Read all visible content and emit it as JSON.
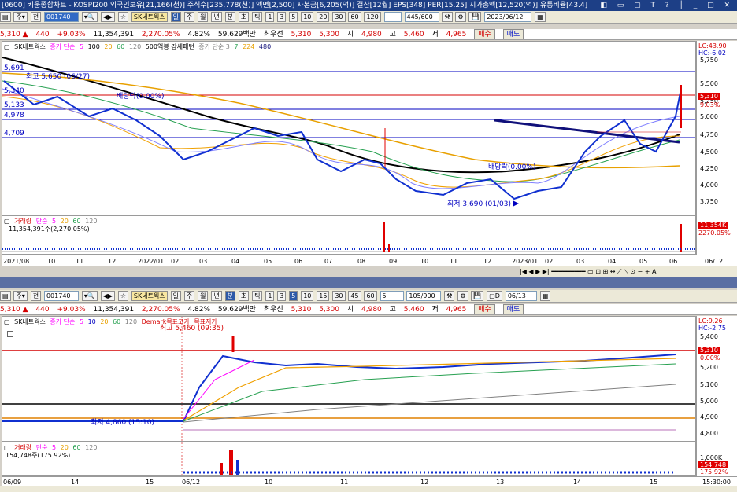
{
  "title": "[0600] 키움종합차트 - KOSPI200 외국인보유[21,166(천)] 주식수[235,778(천)] 액면[2,500] 자본금[6,205(억)] 결산[12월] EPS[348] PER[15.25] 시가총액[12,520(억)] 유통비율[43.4]",
  "top": {
    "toolbar": {
      "code": "001740",
      "name": "SK네트웍스",
      "periods": [
        "일",
        "주",
        "월",
        "년",
        "분",
        "초",
        "틱"
      ],
      "active_period": "일",
      "minutes": [
        "1",
        "3",
        "5",
        "10",
        "20",
        "30",
        "60",
        "120"
      ],
      "count": "445/600",
      "date": "2023/06/12"
    },
    "info": {
      "price": "5,310 ▲",
      "change": "440",
      "rate": "+9.03%",
      "volume": "11,354,391",
      "vol_rate": "2,270.05%",
      "turnover": "4.82%",
      "amount": "59,629백만",
      "pref_label": "최우선",
      "ask": "5,310",
      "bid": "5,300",
      "open_label": "시",
      "open": "4,980",
      "high_label": "고",
      "high": "5,460",
      "low_label": "저",
      "low": "4,965",
      "buy": "매수",
      "sell": "매도"
    },
    "legend": [
      "SK네트웍스",
      "종가 단순",
      "5",
      "100",
      "20",
      "60",
      "120",
      "500억봉 강세패턴",
      "종가 단순 3",
      "7",
      "224",
      "480"
    ],
    "axis_labels": [
      "5,750",
      "5,500",
      "5,250",
      "5,000",
      "4,750",
      "4,500",
      "4,250",
      "4,000",
      "3,750"
    ],
    "hline_labels": [
      "5,691",
      "5,340",
      "5,133",
      "4,978",
      "4,709"
    ],
    "annotations": {
      "high": "최고 5,650 (06/27)",
      "dividend1": "배당락(0.00%)",
      "dividend2": "배당락(0.00%)",
      "low": "최저 3,690 (01/03)"
    },
    "lc": "LC:43.90",
    "hc": "HC:-6.02",
    "price_tag": "5,310",
    "pct_tag": "9.03%",
    "volume_legend": [
      "거래량",
      "단순",
      "5",
      "20",
      "60",
      "120"
    ],
    "volume_value": "11,354,391주(2,270.05%)",
    "volume_tag": "11,354K",
    "volume_pct": "2270.05%",
    "dates": [
      "2021/08",
      "10",
      "11",
      "12",
      "2022/01",
      "02",
      "03",
      "04",
      "05",
      "06",
      "07",
      "08",
      "09",
      "10",
      "11",
      "12",
      "2023/01",
      "02",
      "03",
      "04",
      "05",
      "06",
      "06/12"
    ]
  },
  "bottom": {
    "toolbar": {
      "code": "001740",
      "name": "SK네트웍스",
      "periods": [
        "일",
        "주",
        "월",
        "년",
        "분",
        "초",
        "틱"
      ],
      "active_period": "분",
      "minutes": [
        "1",
        "3",
        "5",
        "10",
        "15",
        "30",
        "45",
        "60"
      ],
      "active_minute": "5",
      "unit": "5",
      "count": "105/900",
      "date": "06/13"
    },
    "info": {
      "price": "5,310 ▲",
      "change": "440",
      "rate": "+9.03%",
      "volume": "11,354,391",
      "vol_rate": "2,270.05%",
      "turnover": "4.82%",
      "amount": "59,629백만",
      "pref_label": "최우선",
      "ask": "5,310",
      "bid": "5,300",
      "open_label": "시",
      "open": "4,980",
      "high_label": "고",
      "high": "5,460",
      "low_label": "저",
      "low": "4,965",
      "buy": "매수",
      "sell": "매도"
    },
    "legend": [
      "SK네트웍스",
      "종가 단순",
      "5",
      "10",
      "20",
      "60",
      "120",
      "Demark목표고가",
      "목표저가"
    ],
    "axis_labels": [
      "5,400",
      "5,300",
      "5,200",
      "5,100",
      "5,000",
      "4,900",
      "4,800"
    ],
    "annotations": {
      "high": "최고 5,460 (09:35)",
      "low": "최저 4,860 (15:10)"
    },
    "lc": "LC:9.26",
    "hc": "HC:-2.75",
    "price_tag": "5,310",
    "pct_tag": "0.00%",
    "volume_legend": [
      "거래량",
      "단순",
      "5",
      "20",
      "60",
      "120"
    ],
    "volume_value": "154,748주(175.92%)",
    "volume_axis": "1,000K",
    "volume_tag": "154,748",
    "volume_pct": "175.92%",
    "dates": [
      "06/09",
      "14",
      "15",
      "06/12",
      "10",
      "11",
      "12",
      "13",
      "14",
      "15",
      "15:30:00"
    ]
  }
}
